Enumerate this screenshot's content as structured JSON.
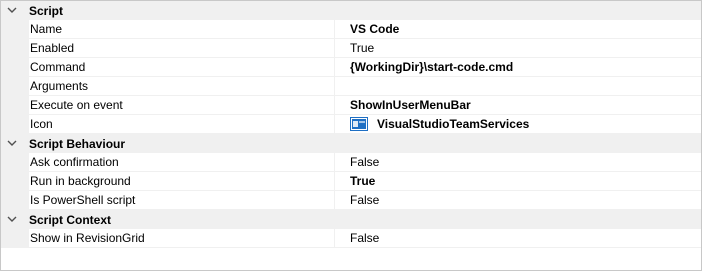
{
  "categories": [
    {
      "title": "Script",
      "props": [
        {
          "name": "Name",
          "value": "VS Code",
          "bold": true
        },
        {
          "name": "Enabled",
          "value": "True",
          "bold": false
        },
        {
          "name": "Command",
          "value": "{WorkingDir}\\start-code.cmd",
          "bold": true
        },
        {
          "name": "Arguments",
          "value": "",
          "bold": false
        },
        {
          "name": "Execute on event",
          "value": "ShowInUserMenuBar",
          "bold": true
        },
        {
          "name": "Icon",
          "value": "VisualStudioTeamServices",
          "bold": true,
          "icon": "visual-studio-team-services-icon"
        }
      ]
    },
    {
      "title": "Script Behaviour",
      "props": [
        {
          "name": "Ask confirmation",
          "value": "False",
          "bold": false
        },
        {
          "name": "Run in background",
          "value": "True",
          "bold": true
        },
        {
          "name": "Is PowerShell script",
          "value": "False",
          "bold": false
        }
      ]
    },
    {
      "title": "Script Context",
      "props": [
        {
          "name": "Show in RevisionGrid",
          "value": "False",
          "bold": false
        }
      ]
    }
  ],
  "colors": {
    "category_bg": "#f0f0f0",
    "border": "#c8c8c8",
    "icon_blue": "#1e6fc4"
  }
}
